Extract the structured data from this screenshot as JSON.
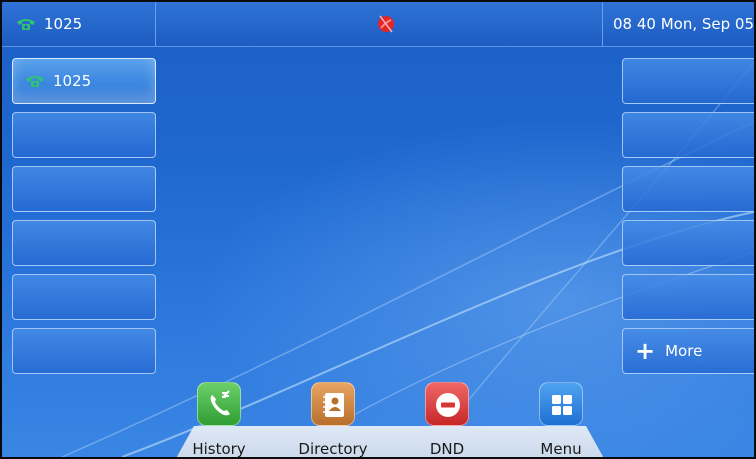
{
  "status_bar": {
    "account": "1025",
    "datetime": "08 40 Mon, Sep 05",
    "center_icon": "no-network-icon"
  },
  "line_keys_left": [
    {
      "label": "1025",
      "icon": "phone-handset-icon",
      "active": true
    },
    {
      "label": ""
    },
    {
      "label": ""
    },
    {
      "label": ""
    },
    {
      "label": ""
    },
    {
      "label": ""
    }
  ],
  "line_keys_right": [
    {
      "label": ""
    },
    {
      "label": ""
    },
    {
      "label": ""
    },
    {
      "label": ""
    },
    {
      "label": ""
    },
    {
      "label": "More",
      "icon": "plus-icon"
    }
  ],
  "dock": [
    {
      "label": "History",
      "icon": "call-history-icon",
      "color": "#3aa83d"
    },
    {
      "label": "Directory",
      "icon": "directory-book-icon",
      "color": "#c9803a"
    },
    {
      "label": "DND",
      "icon": "do-not-disturb-icon",
      "color": "#d93636"
    },
    {
      "label": "Menu",
      "icon": "menu-grid-icon",
      "color": "#2b7fdc"
    }
  ],
  "colors": {
    "background": "#1f68d0",
    "account_icon": "#2fc46f",
    "center_icon": "#e02626"
  }
}
